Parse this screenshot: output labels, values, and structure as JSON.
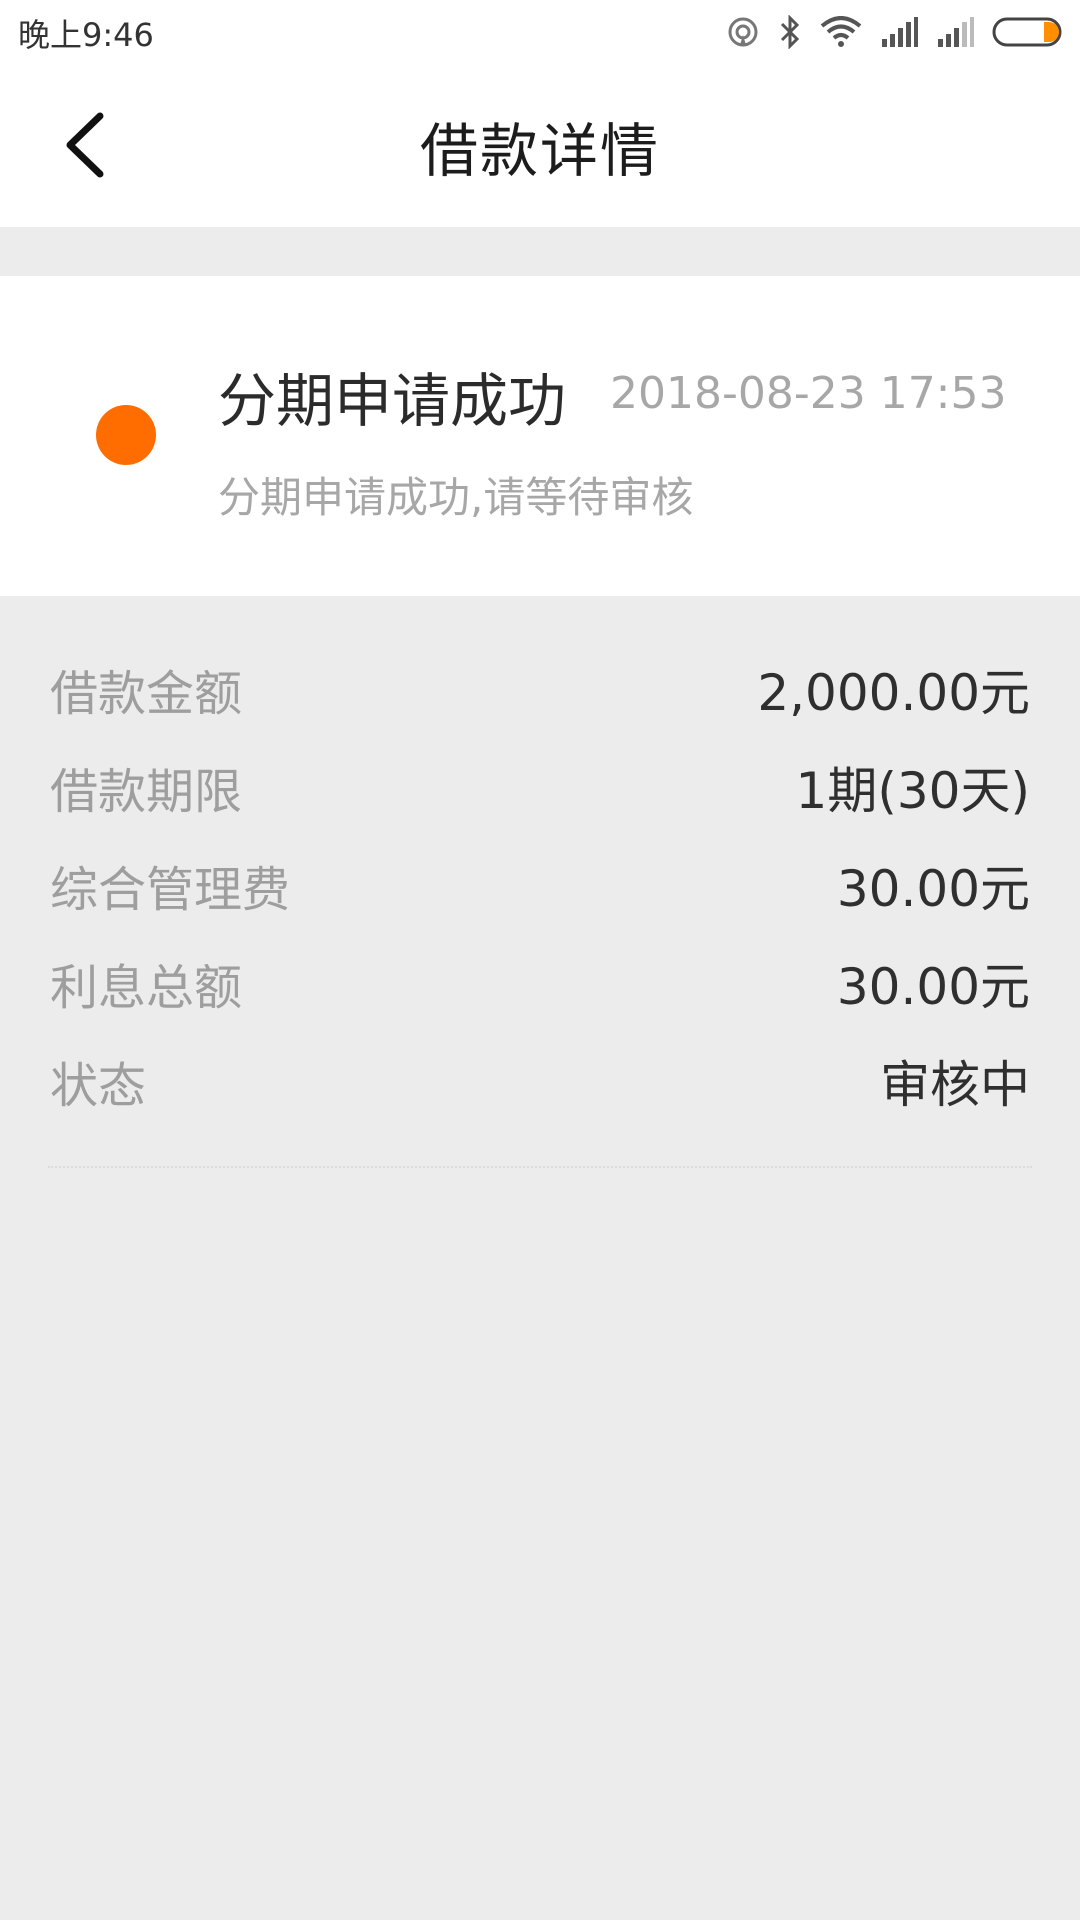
{
  "status_bar": {
    "time": "晚上9:46",
    "icons": [
      "hotspot-icon",
      "bluetooth-icon",
      "wifi-icon",
      "signal-icon",
      "signal-icon",
      "battery-icon"
    ],
    "battery_color": "#ff8f00"
  },
  "header": {
    "title": "借款详情",
    "back_icon": "chevron-left-icon"
  },
  "timeline": {
    "dot_color": "#ff6d00",
    "title": "分期申请成功",
    "time": "2018-08-23 17:53",
    "description": "分期申请成功,请等待审核"
  },
  "details": [
    {
      "label": "借款金额",
      "value": "2,000.00元"
    },
    {
      "label": "借款期限",
      "value": "1期(30天)"
    },
    {
      "label": "综合管理费",
      "value": "30.00元"
    },
    {
      "label": "利息总额",
      "value": "30.00元"
    },
    {
      "label": "状态",
      "value": "审核中"
    }
  ]
}
